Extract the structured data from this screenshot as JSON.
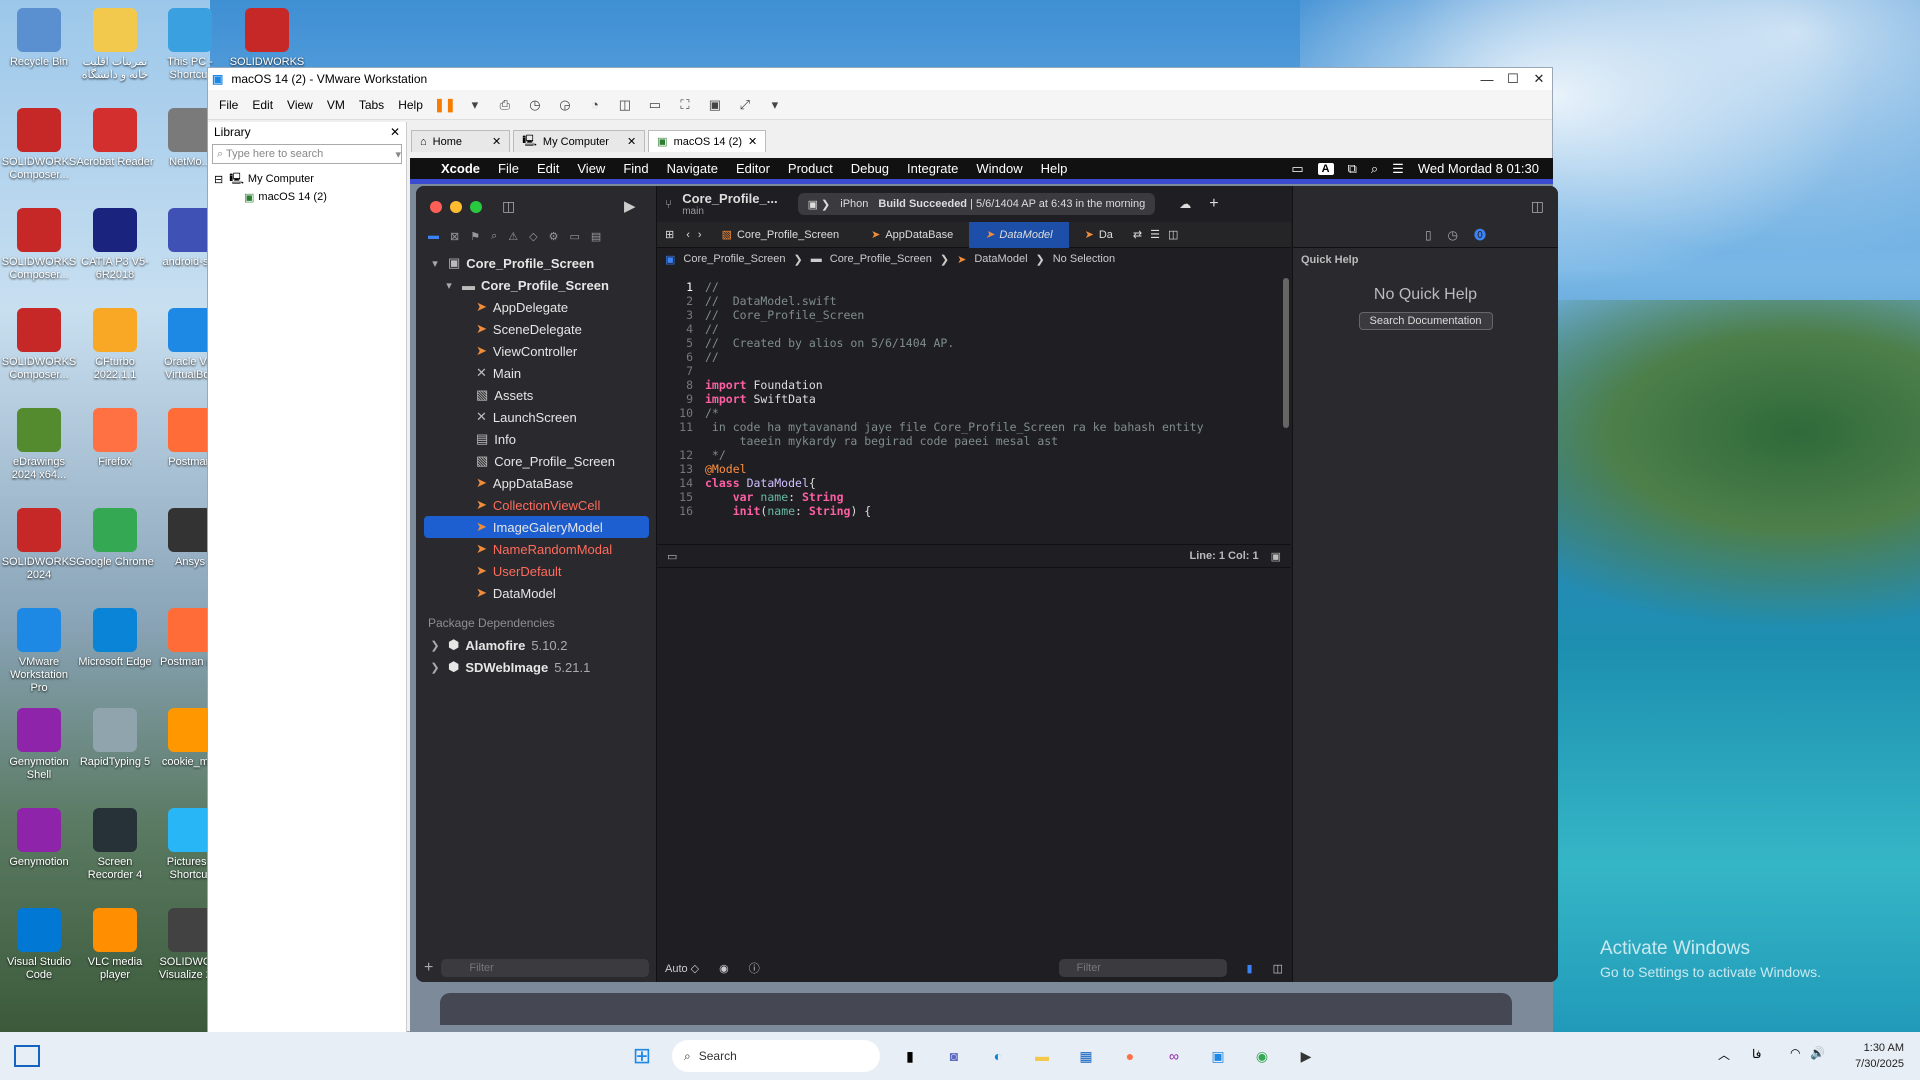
{
  "desktop": {
    "icons": [
      {
        "label": "Recycle Bin",
        "color": "#5a8fd0"
      },
      {
        "label": "تمرینات اقلیت خانه و دانشگاه",
        "color": "#f2c94c"
      },
      {
        "label": "This PC - Shortcut",
        "color": "#3aa0e0"
      },
      {
        "label": "SOLIDWORKS 2024",
        "color": "#c62828"
      },
      {
        "label": "SOLIDWORKS Composer...",
        "color": "#c62828"
      },
      {
        "label": "Acrobat Reader",
        "color": "#d32f2f"
      },
      {
        "label": "NetMo...",
        "color": "#7a7a7a"
      },
      {
        "label": "SOLIDWORKS Composer...",
        "color": "#c62828"
      },
      {
        "label": "CATIA P3 V5-6R2018",
        "color": "#1a237e"
      },
      {
        "label": "android-s...",
        "color": "#3f51b5"
      },
      {
        "label": "SOLIDWORKS Composer...",
        "color": "#c62828"
      },
      {
        "label": "CFturbo 2022.1.1",
        "color": "#f9a825"
      },
      {
        "label": "Oracle VM VirtualBox",
        "color": "#1e88e5"
      },
      {
        "label": "eDrawings 2024 x64...",
        "color": "#558b2f"
      },
      {
        "label": "Firefox",
        "color": "#ff7043"
      },
      {
        "label": "Postman",
        "color": "#ff6c37"
      },
      {
        "label": "SOLIDWORKS 2024",
        "color": "#c62828"
      },
      {
        "label": "Google Chrome",
        "color": "#34a853"
      },
      {
        "label": "Ansys",
        "color": "#333333"
      },
      {
        "label": "VMware Workstation Pro",
        "color": "#1e88e5"
      },
      {
        "label": "Microsoft Edge",
        "color": "#0a84d6"
      },
      {
        "label": "Postman (1)",
        "color": "#ff6c37"
      },
      {
        "label": "Genymotion Shell",
        "color": "#8e24aa"
      },
      {
        "label": "RapidTyping 5",
        "color": "#90a4ae"
      },
      {
        "label": "cookie_m...",
        "color": "#ff9800"
      },
      {
        "label": "Genymotion",
        "color": "#8e24aa"
      },
      {
        "label": "Screen Recorder 4",
        "color": "#263238"
      },
      {
        "label": "Pictures - Shortcut",
        "color": "#29b6f6"
      },
      {
        "label": "Visual Studio Code",
        "color": "#0078d4"
      },
      {
        "label": "VLC media player",
        "color": "#ff8f00"
      },
      {
        "label": "SOLIDWO... Visualize 2...",
        "color": "#424242"
      }
    ],
    "activate_title": "Activate Windows",
    "activate_sub": "Go to Settings to activate Windows."
  },
  "vmware": {
    "title": "macOS 14 (2) - VMware Workstation",
    "menu": [
      "File",
      "Edit",
      "View",
      "VM",
      "Tabs",
      "Help"
    ],
    "library_title": "Library",
    "library_search_placeholder": "Type here to search",
    "tree_root": "My Computer",
    "tree_child": "macOS 14 (2)",
    "tabs": [
      {
        "label": "Home"
      },
      {
        "label": "My Computer"
      },
      {
        "label": "macOS 14 (2)"
      }
    ]
  },
  "mac_menubar": {
    "items": [
      "Xcode",
      "File",
      "Edit",
      "View",
      "Find",
      "Navigate",
      "Editor",
      "Product",
      "Debug",
      "Integrate",
      "Window",
      "Help"
    ],
    "input_badge": "A",
    "clock": "Wed Mordad 8  01:30"
  },
  "xcode": {
    "scheme": "Core_Profile_...",
    "branch": "main",
    "destination": "iPhon",
    "build_status_bold": "Build Succeeded",
    "build_status_rest": "| 5/6/1404 AP at 6:43 in the morning",
    "editor_tabs": [
      "Core_Profile_Screen",
      "AppDataBase",
      "DataModel",
      "Da"
    ],
    "breadcrumb": [
      "Core_Profile_Screen",
      "Core_Profile_Screen",
      "DataModel",
      "No Selection"
    ],
    "navigator": [
      {
        "label": "Core_Profile_Screen",
        "level": 0,
        "glyph": "▾",
        "icon": "▣",
        "bold": true
      },
      {
        "label": "Core_Profile_Screen",
        "level": 1,
        "glyph": "▾",
        "icon": "▬",
        "bold": true
      },
      {
        "label": "AppDelegate",
        "level": 2,
        "icon": "➤"
      },
      {
        "label": "SceneDelegate",
        "level": 2,
        "icon": "➤"
      },
      {
        "label": "ViewController",
        "level": 2,
        "icon": "➤"
      },
      {
        "label": "Main",
        "level": 2,
        "icon": "✕"
      },
      {
        "label": "Assets",
        "level": 2,
        "icon": "▧"
      },
      {
        "label": "LaunchScreen",
        "level": 2,
        "icon": "✕"
      },
      {
        "label": "Info",
        "level": 2,
        "icon": "▤"
      },
      {
        "label": "Core_Profile_Screen",
        "level": 2,
        "icon": "▧"
      },
      {
        "label": "AppDataBase",
        "level": 2,
        "icon": "➤"
      },
      {
        "label": "CollectionViewCell",
        "level": 2,
        "icon": "➤",
        "red": true
      },
      {
        "label": "ImageGaleryModel",
        "level": 2,
        "icon": "➤",
        "selected": true
      },
      {
        "label": "NameRandomModal",
        "level": 2,
        "icon": "➤",
        "red": true
      },
      {
        "label": "UserDefault",
        "level": 2,
        "icon": "➤",
        "red": true
      },
      {
        "label": "DataModel",
        "level": 2,
        "icon": "➤"
      }
    ],
    "package_header": "Package Dependencies",
    "packages": [
      {
        "name": "Alamofire",
        "version": "5.10.2"
      },
      {
        "name": "SDWebImage",
        "version": "5.21.1"
      }
    ],
    "code_lines": [
      {
        "n": "1",
        "t": "//",
        "c": "cm"
      },
      {
        "n": "2",
        "t": "//  DataModel.swift",
        "c": "cm"
      },
      {
        "n": "3",
        "t": "//  Core_Profile_Screen",
        "c": "cm"
      },
      {
        "n": "4",
        "t": "//",
        "c": "cm"
      },
      {
        "n": "5",
        "t": "//  Created by alios on 5/6/1404 AP.",
        "c": "cm"
      },
      {
        "n": "6",
        "t": "//",
        "c": "cm"
      },
      {
        "n": "7",
        "t": "",
        "c": ""
      },
      {
        "n": "8",
        "t": "import Foundation",
        "c": "imp"
      },
      {
        "n": "9",
        "t": "import SwiftData",
        "c": "imp"
      },
      {
        "n": "10",
        "t": "/*",
        "c": "cm"
      },
      {
        "n": "11",
        "t": " in code ha mytavanand jaye file Core_Profile_Screen ra ke bahash entity",
        "c": "cm"
      },
      {
        "n": "",
        "t": "     taeein mykardy ra begirad code paeei mesal ast",
        "c": "cm"
      },
      {
        "n": "12",
        "t": " */",
        "c": "cm"
      },
      {
        "n": "13",
        "t": "@Model",
        "c": "at"
      },
      {
        "n": "14",
        "t": "class DataModel{",
        "c": "cls"
      },
      {
        "n": "15",
        "t": "    var name: String",
        "c": "var"
      },
      {
        "n": "16",
        "t": "    init(name: String) {",
        "c": "init"
      }
    ],
    "cursor": "Line: 1  Col: 1",
    "filter_placeholder": "Filter",
    "auto_label": "Auto ◇",
    "quick_help_title": "Quick Help",
    "no_quick_help": "No Quick Help",
    "search_docs": "Search Documentation"
  },
  "taskbar": {
    "search_placeholder": "Search",
    "lang": "فا",
    "time": "1:30 AM",
    "date": "7/30/2025"
  }
}
